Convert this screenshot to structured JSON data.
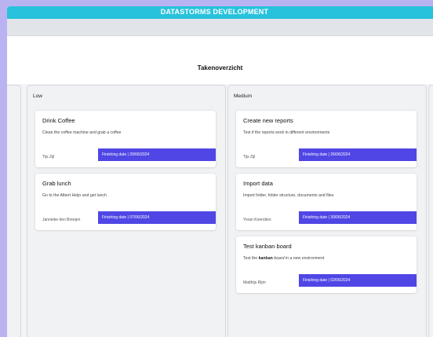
{
  "app": {
    "title": "DATASTORMS DEVELOPMENT"
  },
  "page": {
    "title": "Takenoverzicht"
  },
  "columns": [
    {
      "title": "Low",
      "cards": [
        {
          "title": "Drink Coffee",
          "description": "Clean the coffee machine and grab a coffee",
          "owner": "Tijs Zijl",
          "date": "Finishing date | 20/06/2024"
        },
        {
          "title": "Grab lunch",
          "description": "Go to the Albert Heijn and get lunch",
          "owner": "Jannieke den Breejen",
          "date": "Finishing date | 07/06/2024"
        }
      ]
    },
    {
      "title": "Medium",
      "cards": [
        {
          "title": "Create new reports",
          "description": "Test if the reports work in different environments",
          "owner": "Tijs Zijl",
          "date": "Finishing date | 26/06/2024"
        },
        {
          "title": "Import data",
          "description": "Import folder, folder structure, documents and files",
          "owner": "Yoran Koenders",
          "date": "Finishing date | 30/06/2024"
        },
        {
          "title": "Test kanban board",
          "description_pre": "Test the ",
          "description_bold": "kanban",
          "description_italic": "board",
          "description_post": " in a new environment",
          "owner": "Matthijs Rijm",
          "date": "Finishing date | 02/06/2024"
        }
      ]
    }
  ],
  "colors": {
    "header": "#28c2dc",
    "accent": "#4f46e5",
    "frame": "#b9b3f1"
  }
}
